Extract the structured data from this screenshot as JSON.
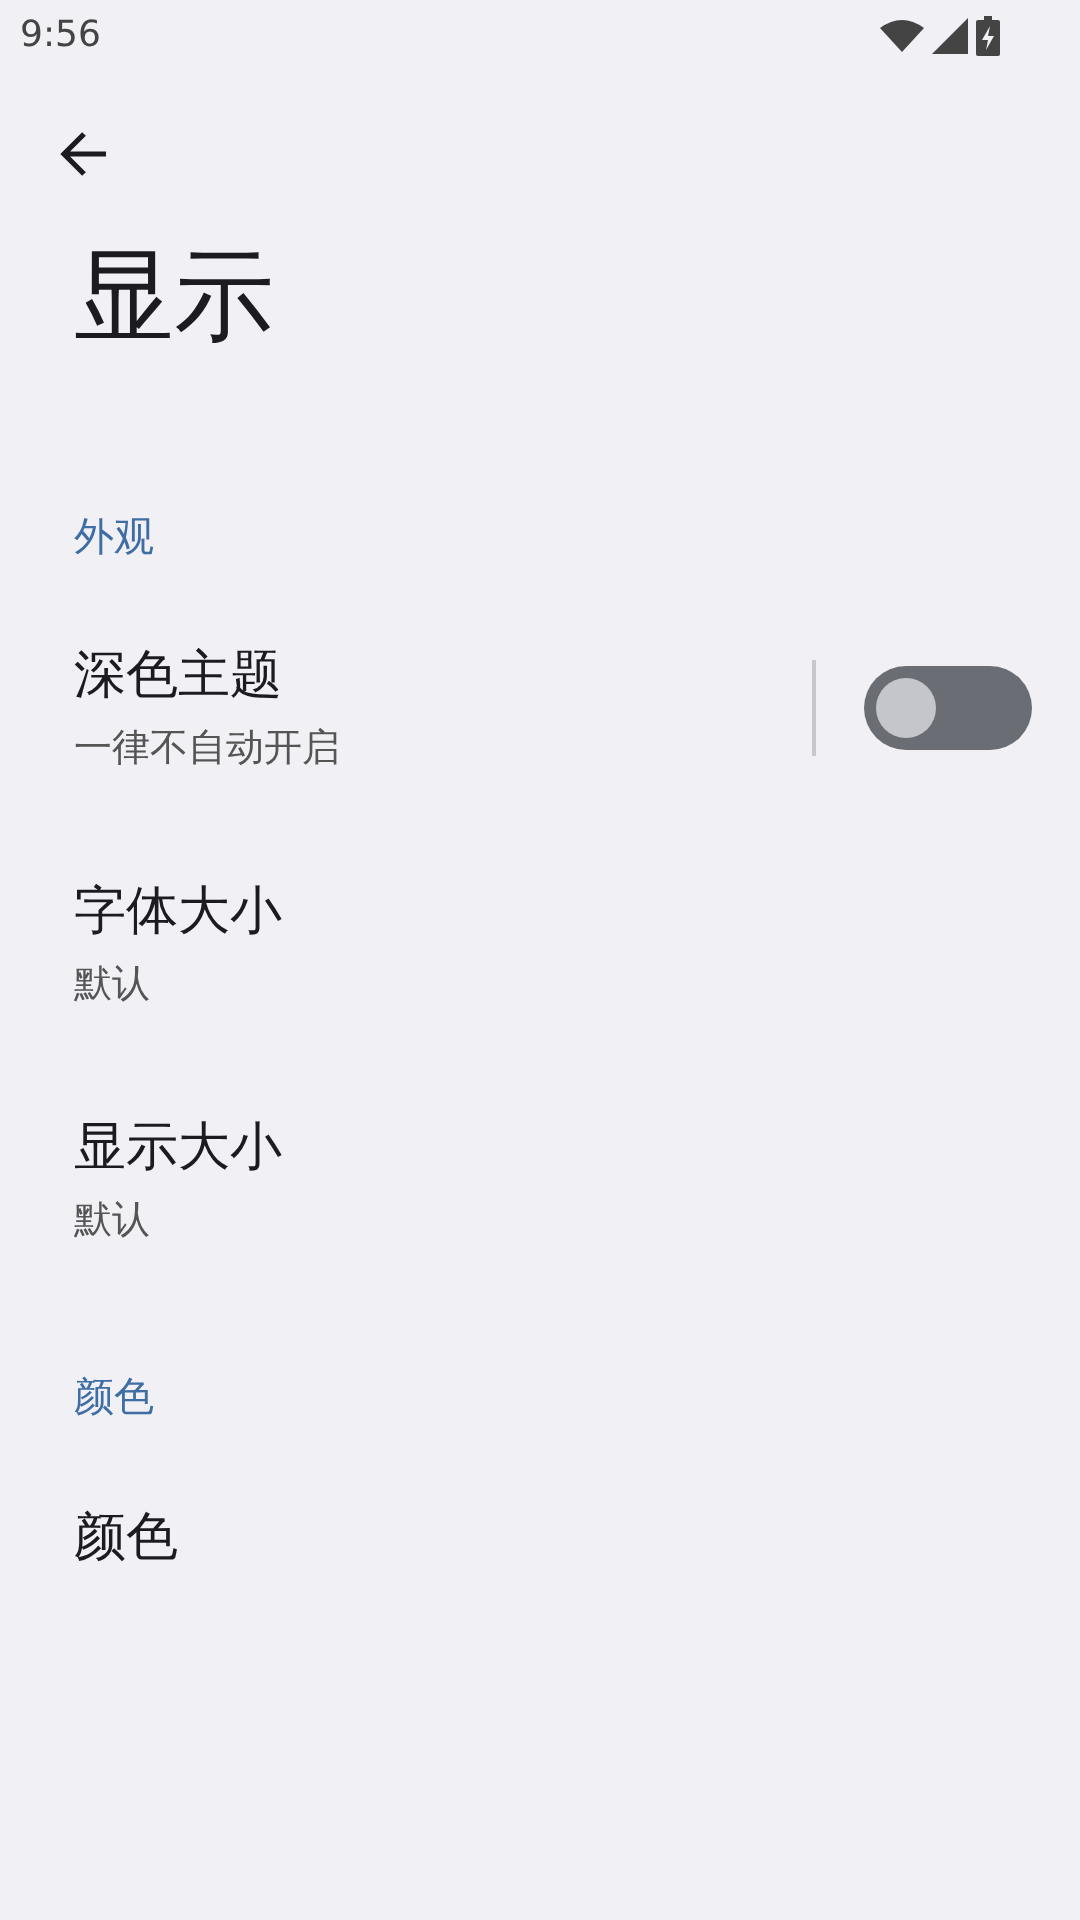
{
  "status_bar": {
    "time": "9:56"
  },
  "title": "显示",
  "sections": [
    {
      "header": "外观",
      "items": [
        {
          "kind": "switch",
          "title": "深色主题",
          "subtitle": "一律不自动开启",
          "on": false
        },
        {
          "kind": "plain",
          "title": "字体大小",
          "subtitle": "默认"
        },
        {
          "kind": "plain",
          "title": "显示大小",
          "subtitle": "默认"
        }
      ]
    },
    {
      "header": "颜色",
      "items": [
        {
          "kind": "plain",
          "title": "颜色"
        }
      ]
    }
  ]
}
